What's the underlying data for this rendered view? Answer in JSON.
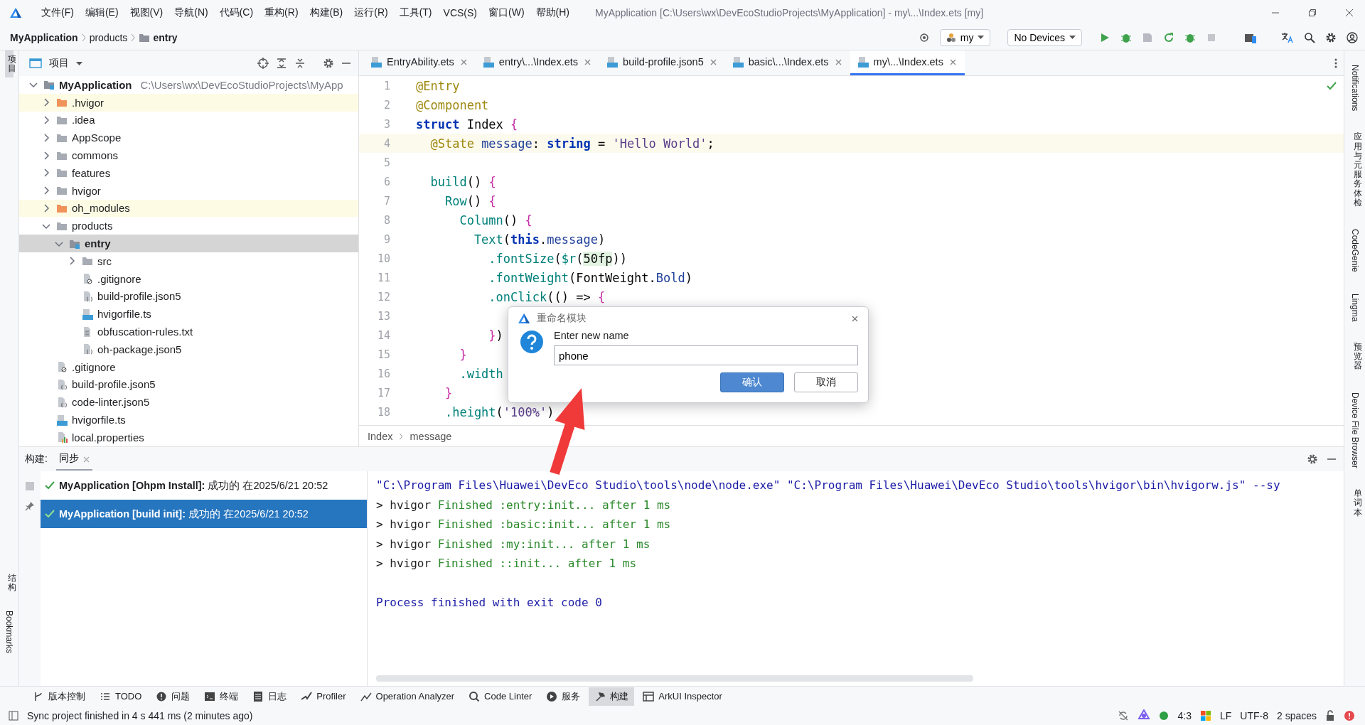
{
  "title_bar": {
    "menus": [
      "文件(F)",
      "编辑(E)",
      "视图(V)",
      "导航(N)",
      "代码(C)",
      "重构(R)",
      "构建(B)",
      "运行(R)",
      "工具(T)",
      "VCS(S)",
      "窗口(W)",
      "帮助(H)"
    ],
    "title": "MyApplication [C:\\Users\\wx\\DevEcoStudioProjects\\MyApplication] - my\\...\\Index.ets [my]"
  },
  "nav_bar": {
    "breadcrumbs": [
      "MyApplication",
      "products",
      "entry"
    ],
    "run_config": "my",
    "device": "No Devices"
  },
  "left_strip": {
    "top_tabs": [
      {
        "label": "项目",
        "kind": "cjk",
        "selected": true
      }
    ],
    "bottom_tabs": [
      {
        "label": "结构",
        "kind": "cjk",
        "selected": false
      },
      {
        "label": "Bookmarks",
        "kind": "latin",
        "selected": false
      }
    ]
  },
  "project_panel": {
    "title": "项目",
    "tree": [
      {
        "name": "MyApplication",
        "path": "C:\\Users\\wx\\DevEcoStudioProjects\\MyApp",
        "kind": "project",
        "expanded": true,
        "selected": false,
        "excluded": false,
        "children": [
          {
            "name": ".hvigor",
            "kind": "folder",
            "expanded": false,
            "selected": false,
            "excluded": true
          },
          {
            "name": ".idea",
            "kind": "folder",
            "expanded": false,
            "selected": false,
            "excluded": false
          },
          {
            "name": "AppScope",
            "kind": "folder",
            "expanded": false,
            "selected": false,
            "excluded": false
          },
          {
            "name": "commons",
            "kind": "folder",
            "expanded": false,
            "selected": false,
            "excluded": false
          },
          {
            "name": "features",
            "kind": "folder",
            "expanded": false,
            "selected": false,
            "excluded": false
          },
          {
            "name": "hvigor",
            "kind": "folder",
            "expanded": false,
            "selected": false,
            "excluded": false
          },
          {
            "name": "oh_modules",
            "kind": "folder",
            "expanded": false,
            "selected": false,
            "excluded": true
          },
          {
            "name": "products",
            "kind": "folder",
            "expanded": true,
            "selected": false,
            "excluded": false,
            "children": [
              {
                "name": "entry",
                "kind": "module",
                "expanded": true,
                "selected": true,
                "excluded": false,
                "children": [
                  {
                    "name": "src",
                    "kind": "folder",
                    "expanded": false,
                    "selected": false,
                    "excluded": false
                  },
                  {
                    "name": ".gitignore",
                    "kind": "ignore",
                    "selected": false,
                    "excluded": false
                  },
                  {
                    "name": "build-profile.json5",
                    "kind": "json",
                    "selected": false,
                    "excluded": false
                  },
                  {
                    "name": "hvigorfile.ts",
                    "kind": "ts",
                    "selected": false,
                    "excluded": false
                  },
                  {
                    "name": "obfuscation-rules.txt",
                    "kind": "text",
                    "selected": false,
                    "excluded": false
                  },
                  {
                    "name": "oh-package.json5",
                    "kind": "json",
                    "selected": false,
                    "excluded": false
                  }
                ]
              }
            ]
          },
          {
            "name": ".gitignore",
            "kind": "ignore",
            "selected": false,
            "excluded": false
          },
          {
            "name": "build-profile.json5",
            "kind": "json",
            "selected": false,
            "excluded": false
          },
          {
            "name": "code-linter.json5",
            "kind": "json",
            "selected": false,
            "excluded": false
          },
          {
            "name": "hvigorfile.ts",
            "kind": "ts",
            "selected": false,
            "excluded": false
          },
          {
            "name": "local.properties",
            "kind": "properties",
            "selected": false,
            "excluded": false
          }
        ]
      }
    ]
  },
  "editor": {
    "tabs": [
      {
        "label": "EntryAbility.ets",
        "selected": false
      },
      {
        "label": "entry\\...\\Index.ets",
        "selected": false
      },
      {
        "label": "build-profile.json5",
        "selected": false
      },
      {
        "label": "basic\\...\\Index.ets",
        "selected": false
      },
      {
        "label": "my\\...\\Index.ets",
        "selected": true
      }
    ],
    "lines": [
      {
        "number": "1",
        "current": false,
        "tokens": [
          {
            "text": "@Entry",
            "kind": "decorator"
          }
        ]
      },
      {
        "number": "2",
        "current": false,
        "tokens": [
          {
            "text": "@Component",
            "kind": "decorator"
          }
        ]
      },
      {
        "number": "3",
        "current": false,
        "tokens": [
          {
            "text": "struct",
            "kind": "keyword"
          },
          {
            "text": " Index ",
            "kind": "plain"
          },
          {
            "text": "{",
            "kind": "brace"
          }
        ]
      },
      {
        "number": "4",
        "current": true,
        "tokens": [
          {
            "text": "  @State",
            "kind": "decorator"
          },
          {
            "text": " message",
            "kind": "property"
          },
          {
            "text": ": ",
            "kind": "plain"
          },
          {
            "text": "string",
            "kind": "keyword"
          },
          {
            "text": " = ",
            "kind": "plain"
          },
          {
            "text": "'Hello World'",
            "kind": "string"
          },
          {
            "text": ";",
            "kind": "plain"
          }
        ]
      },
      {
        "number": "5",
        "current": false
      },
      {
        "number": "6",
        "current": false,
        "tokens": [
          {
            "text": "  build",
            "kind": "method"
          },
          {
            "text": "() ",
            "kind": "plain"
          },
          {
            "text": "{",
            "kind": "brace"
          }
        ]
      },
      {
        "number": "7",
        "current": false,
        "tokens": [
          {
            "text": "    Row",
            "kind": "component"
          },
          {
            "text": "() ",
            "kind": "plain"
          },
          {
            "text": "{",
            "kind": "brace"
          }
        ]
      },
      {
        "number": "8",
        "current": false,
        "tokens": [
          {
            "text": "      Column",
            "kind": "component"
          },
          {
            "text": "() ",
            "kind": "plain"
          },
          {
            "text": "{",
            "kind": "brace"
          }
        ]
      },
      {
        "number": "9",
        "current": false,
        "tokens": [
          {
            "text": "        Text",
            "kind": "component"
          },
          {
            "text": "(",
            "kind": "plain"
          },
          {
            "text": "this",
            "kind": "keyword"
          },
          {
            "text": ".",
            "kind": "plain"
          },
          {
            "text": "message",
            "kind": "property"
          },
          {
            "text": ")",
            "kind": "plain"
          }
        ]
      },
      {
        "number": "10",
        "current": false,
        "tokens": [
          {
            "text": "          .fontSize",
            "kind": "method"
          },
          {
            "text": "(",
            "kind": "plain"
          },
          {
            "text": "$r",
            "kind": "method"
          },
          {
            "text": "(",
            "kind": "plain"
          },
          {
            "text": "50fp",
            "kind": "number"
          },
          {
            "text": "))",
            "kind": "plain"
          }
        ]
      },
      {
        "number": "11",
        "current": false,
        "tokens": [
          {
            "text": "          .fontWeight",
            "kind": "method"
          },
          {
            "text": "(FontWeight.",
            "kind": "plain"
          },
          {
            "text": "Bold",
            "kind": "property"
          },
          {
            "text": ")",
            "kind": "plain"
          }
        ]
      },
      {
        "number": "12",
        "current": false,
        "tokens": [
          {
            "text": "          .onClick",
            "kind": "method"
          },
          {
            "text": "(() => ",
            "kind": "plain"
          },
          {
            "text": "{",
            "kind": "brace"
          }
        ]
      },
      {
        "number": "13",
        "current": false
      },
      {
        "number": "14",
        "current": false,
        "tokens": [
          {
            "text": "          }",
            "kind": "brace"
          },
          {
            "text": ")",
            "kind": "plain"
          }
        ]
      },
      {
        "number": "15",
        "current": false,
        "tokens": [
          {
            "text": "      }",
            "kind": "brace"
          }
        ]
      },
      {
        "number": "16",
        "current": false,
        "tokens": [
          {
            "text": "      .width",
            "kind": "method"
          }
        ]
      },
      {
        "number": "17",
        "current": false,
        "tokens": [
          {
            "text": "    }",
            "kind": "brace"
          }
        ]
      },
      {
        "number": "18",
        "current": false,
        "tokens": [
          {
            "text": "    .height",
            "kind": "method"
          },
          {
            "text": "(",
            "kind": "plain"
          },
          {
            "text": "'100%'",
            "kind": "string"
          },
          {
            "text": ")",
            "kind": "plain"
          }
        ]
      }
    ],
    "breadcrumbs": [
      "Index",
      "message"
    ]
  },
  "dialog": {
    "title": "重命名模块",
    "prompt": "Enter new name",
    "value": "phone",
    "buttons": [
      {
        "label": "确认",
        "primary": true
      },
      {
        "label": "取消",
        "primary": false
      }
    ]
  },
  "right_strip": {
    "tabs": [
      {
        "label": "Notifications",
        "kind": "latin"
      },
      {
        "label": "应用与元服务体检",
        "kind": "cjk"
      },
      {
        "label": "CodeGenie",
        "kind": "latin"
      },
      {
        "label": "Lingma",
        "kind": "latin"
      },
      {
        "label": "预览器",
        "kind": "cjk"
      },
      {
        "label": "Device File Browser",
        "kind": "latin"
      },
      {
        "label": "单词本",
        "kind": "cjk"
      }
    ]
  },
  "build_panel": {
    "label": "构建:",
    "tabs": [
      {
        "label": "同步",
        "selected": true
      }
    ],
    "items": [
      {
        "text": "**MyApplication [Ohpm Install]:** 成功的 在2025/6/21 20:52",
        "selected": false
      },
      {
        "text": "**MyApplication [build init]:** 成功的 在2025/6/21 20:52",
        "selected": true
      }
    ],
    "console": [
      [
        {
          "text": "\"C:\\Program Files\\Huawei\\DevEco Studio\\tools\\node\\node.exe\" \"C:\\Program Files\\Huawei\\DevEco Studio\\tools\\hvigor\\bin\\hvigorw.js\" --sy",
          "kind": "command"
        }
      ],
      [
        {
          "text": "> hvigor ",
          "kind": "plain"
        },
        {
          "text": "Finished :entry:init... after 1 ms",
          "kind": "success"
        }
      ],
      [
        {
          "text": "> hvigor ",
          "kind": "plain"
        },
        {
          "text": "Finished :basic:init... after 1 ms",
          "kind": "success"
        }
      ],
      [
        {
          "text": "> hvigor ",
          "kind": "plain"
        },
        {
          "text": "Finished :my:init... after 1 ms",
          "kind": "success"
        }
      ],
      [
        {
          "text": "> hvigor ",
          "kind": "plain"
        },
        {
          "text": "Finished ::init... after 1 ms",
          "kind": "success"
        }
      ]
    ],
    "summary": [
      {
        "text": "Process finished with exit code 0",
        "kind": "command"
      }
    ]
  },
  "tool_bar": {
    "items": [
      {
        "label": "版本控制",
        "selected": false
      },
      {
        "label": "TODO",
        "selected": false
      },
      {
        "label": "问题",
        "selected": false
      },
      {
        "label": "终端",
        "selected": false
      },
      {
        "label": "日志",
        "selected": false
      },
      {
        "label": "Profiler",
        "selected": false
      },
      {
        "label": "Operation Analyzer",
        "selected": false
      },
      {
        "label": "Code Linter",
        "selected": false
      },
      {
        "label": "服务",
        "selected": false
      },
      {
        "label": "构建",
        "selected": true
      },
      {
        "label": "ArkUI Inspector",
        "selected": false
      }
    ]
  },
  "status_bar": {
    "message": "Sync project finished in 4 s 441 ms (2 minutes ago)",
    "position": "4:3",
    "line_separator": "LF",
    "encoding": "UTF-8",
    "indent": "2 spaces"
  },
  "annotation": {
    "kind": "arrow"
  }
}
